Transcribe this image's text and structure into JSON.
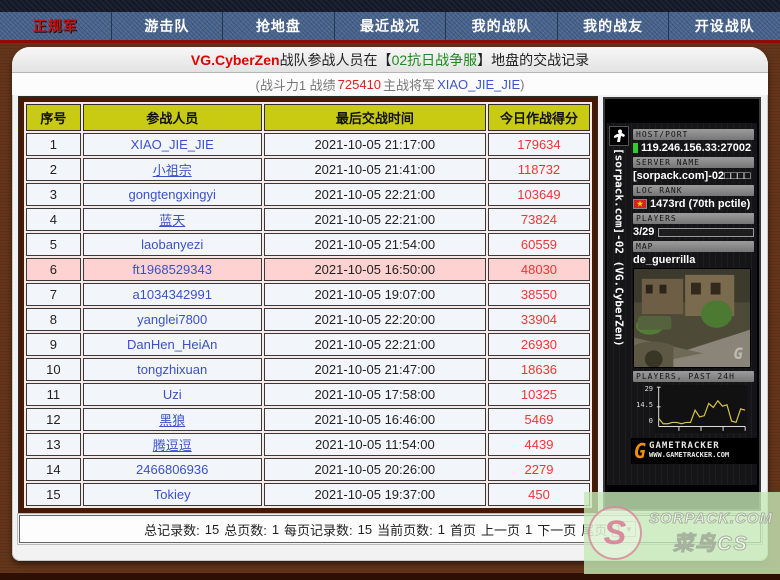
{
  "nav": {
    "items": [
      {
        "label": "正规军",
        "active": true
      },
      {
        "label": "游击队",
        "active": false
      },
      {
        "label": "抢地盘",
        "active": false
      },
      {
        "label": "最近战况",
        "active": false
      },
      {
        "label": "我的战队",
        "active": false
      },
      {
        "label": "我的战友",
        "active": false
      },
      {
        "label": "开设战队",
        "active": false
      }
    ]
  },
  "header": {
    "team": "VG.CyberZen",
    "mid": "战队参战人员在【",
    "server": "02抗日战争服",
    "tail": "】地盘的交战记录"
  },
  "subheader": {
    "prefix": "(战斗力1 战绩",
    "score": "725410",
    "mid": "主战将军",
    "general": "XIAO_JIE_JIE",
    "suffix": ")"
  },
  "table": {
    "columns": [
      "序号",
      "参战人员",
      "最后交战时间",
      "今日作战得分"
    ],
    "rows": [
      {
        "no": "1",
        "name": "XIAO_JIE_JIE",
        "time": "2021-10-05 21:17:00",
        "score": "179634",
        "highlight": false,
        "underline": false
      },
      {
        "no": "2",
        "name": "小祖宗",
        "time": "2021-10-05 21:41:00",
        "score": "118732",
        "highlight": false,
        "underline": true
      },
      {
        "no": "3",
        "name": "gongtengxingyi",
        "time": "2021-10-05 22:21:00",
        "score": "103649",
        "highlight": false,
        "underline": false
      },
      {
        "no": "4",
        "name": "蓝天",
        "time": "2021-10-05 22:21:00",
        "score": "73824",
        "highlight": false,
        "underline": true
      },
      {
        "no": "5",
        "name": "laobanyezi",
        "time": "2021-10-05 21:54:00",
        "score": "60559",
        "highlight": false,
        "underline": false
      },
      {
        "no": "6",
        "name": "ft1968529343",
        "time": "2021-10-05 16:50:00",
        "score": "48030",
        "highlight": true,
        "underline": false
      },
      {
        "no": "7",
        "name": "a1034342991",
        "time": "2021-10-05 19:07:00",
        "score": "38550",
        "highlight": false,
        "underline": false
      },
      {
        "no": "8",
        "name": "yanglei7800",
        "time": "2021-10-05 22:20:00",
        "score": "33904",
        "highlight": false,
        "underline": false
      },
      {
        "no": "9",
        "name": "DanHen_HeiAn",
        "time": "2021-10-05 22:21:00",
        "score": "26930",
        "highlight": false,
        "underline": false
      },
      {
        "no": "10",
        "name": "tongzhixuan",
        "time": "2021-10-05 21:47:00",
        "score": "18636",
        "highlight": false,
        "underline": false
      },
      {
        "no": "11",
        "name": "Uzi",
        "time": "2021-10-05 17:58:00",
        "score": "10325",
        "highlight": false,
        "underline": false
      },
      {
        "no": "12",
        "name": "黑狼",
        "time": "2021-10-05 16:46:00",
        "score": "5469",
        "highlight": false,
        "underline": true
      },
      {
        "no": "13",
        "name": "腾逗逗",
        "time": "2021-10-05 11:54:00",
        "score": "4439",
        "highlight": false,
        "underline": true
      },
      {
        "no": "14",
        "name": "2466806936",
        "time": "2021-10-05 20:26:00",
        "score": "2279",
        "highlight": false,
        "underline": false
      },
      {
        "no": "15",
        "name": "Tokiey",
        "time": "2021-10-05 19:37:00",
        "score": "450",
        "highlight": false,
        "underline": false
      }
    ]
  },
  "widget": {
    "vertical_text": "[sorpack.com]-02  (VG.CyberZen)",
    "host_label": "HOST/PORT",
    "host_value": "119.246.156.33:27002",
    "server_label": "SERVER NAME",
    "server_value": "[sorpack.com]-02□□□□",
    "rank_label": "LOC  RANK",
    "rank_value": "1473rd (70th pctile)",
    "flag_star": "★",
    "players_label": "PLAYERS",
    "players_value": "3/29",
    "players_pct": 10,
    "map_label": "MAP",
    "map_value": "de_guerrilla",
    "graph_label": "PLAYERS,  PAST  24H",
    "graph": {
      "type": "line",
      "title": "Players, past 24h",
      "ylim": [
        0,
        29
      ],
      "ticks": [
        "29",
        "14.5",
        "0"
      ],
      "values": [
        6,
        2,
        2,
        3,
        3,
        2,
        3,
        3,
        12,
        7,
        8,
        17,
        14,
        19,
        15,
        16,
        4,
        3,
        13,
        12
      ],
      "line_color": "#d8c34a"
    },
    "logo_g": "G",
    "logo_line1": "GAMETRACKER",
    "logo_line2": "WWW.GAMETRACKER.COM"
  },
  "pagination": {
    "total_records_label": "总记录数:",
    "total_records": "15",
    "total_pages_label": "总页数:",
    "total_pages": "1",
    "per_page_label": "每页记录数:",
    "per_page": "15",
    "current_page_label": "当前页数:",
    "current_page": "1",
    "first": "首页",
    "prev": "上一页",
    "page_num": "1",
    "next": "下一页",
    "last": "尾页",
    "page_select": "1"
  },
  "watermark": {
    "logo": "S",
    "line1": "SORPACK.COM",
    "line2": "菜鸟CS"
  },
  "colors": {
    "accent_red": "#e00000",
    "accent_green": "#1c8a1c",
    "link_blue": "#3c50c8",
    "header_yellow": "#c9cb12",
    "table_border_maroon": "#471a06",
    "highlight_pink": "#ffd2d2",
    "progress_orange": "#f0a000"
  }
}
